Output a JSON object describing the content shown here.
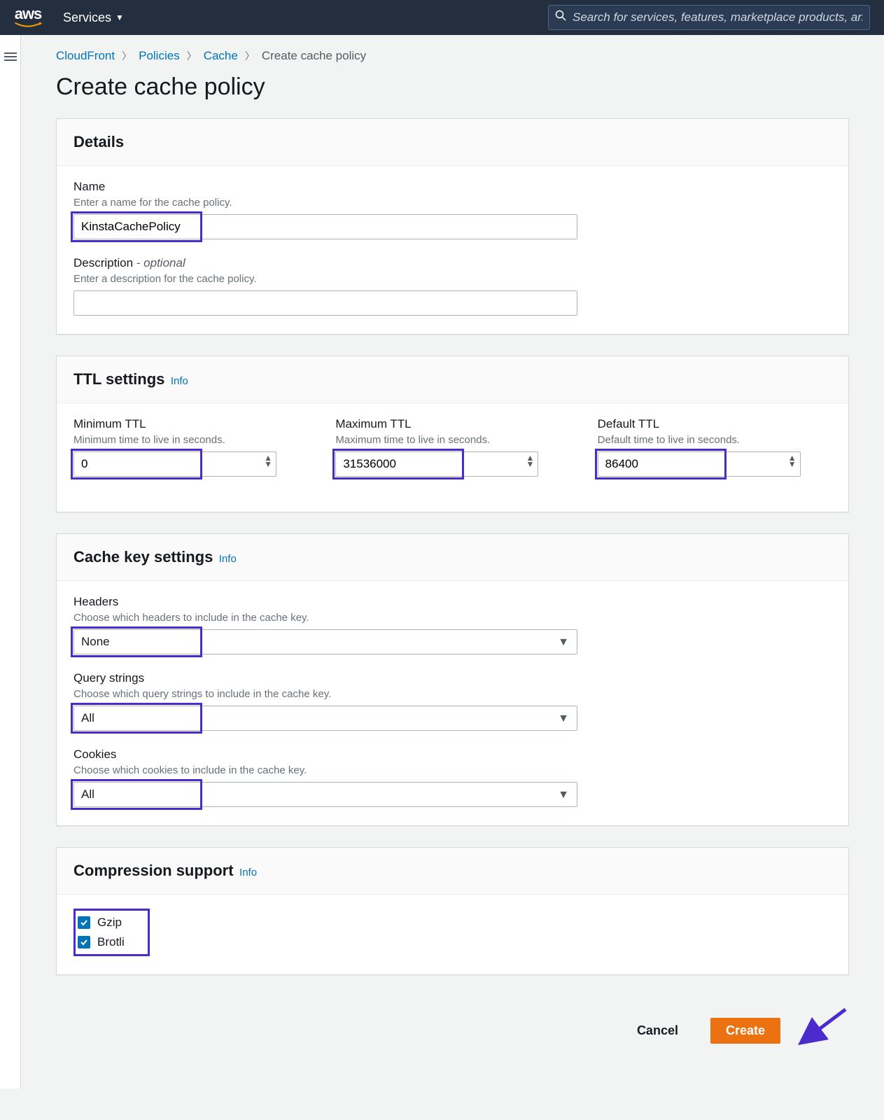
{
  "topbar": {
    "logo_text": "aws",
    "services_label": "Services",
    "search_placeholder": "Search for services, features, marketplace products, and"
  },
  "breadcrumbs": {
    "items": [
      "CloudFront",
      "Policies",
      "Cache"
    ],
    "current": "Create cache policy"
  },
  "page_title": "Create cache policy",
  "details": {
    "title": "Details",
    "name_label": "Name",
    "name_hint": "Enter a name for the cache policy.",
    "name_value": "KinstaCachePolicy",
    "desc_label": "Description",
    "desc_optional": "- optional",
    "desc_hint": "Enter a description for the cache policy.",
    "desc_value": ""
  },
  "ttl": {
    "title": "TTL settings",
    "info": "Info",
    "min_label": "Minimum TTL",
    "min_hint": "Minimum time to live in seconds.",
    "min_value": "0",
    "max_label": "Maximum TTL",
    "max_hint": "Maximum time to live in seconds.",
    "max_value": "31536000",
    "def_label": "Default TTL",
    "def_hint": "Default time to live in seconds.",
    "def_value": "86400"
  },
  "cachekey": {
    "title": "Cache key settings",
    "info": "Info",
    "headers_label": "Headers",
    "headers_hint": "Choose which headers to include in the cache key.",
    "headers_value": "None",
    "query_label": "Query strings",
    "query_hint": "Choose which query strings to include in the cache key.",
    "query_value": "All",
    "cookies_label": "Cookies",
    "cookies_hint": "Choose which cookies to include in the cache key.",
    "cookies_value": "All"
  },
  "compression": {
    "title": "Compression support",
    "info": "Info",
    "gzip_label": "Gzip",
    "gzip_checked": true,
    "brotli_label": "Brotli",
    "brotli_checked": true
  },
  "actions": {
    "cancel": "Cancel",
    "create": "Create"
  }
}
